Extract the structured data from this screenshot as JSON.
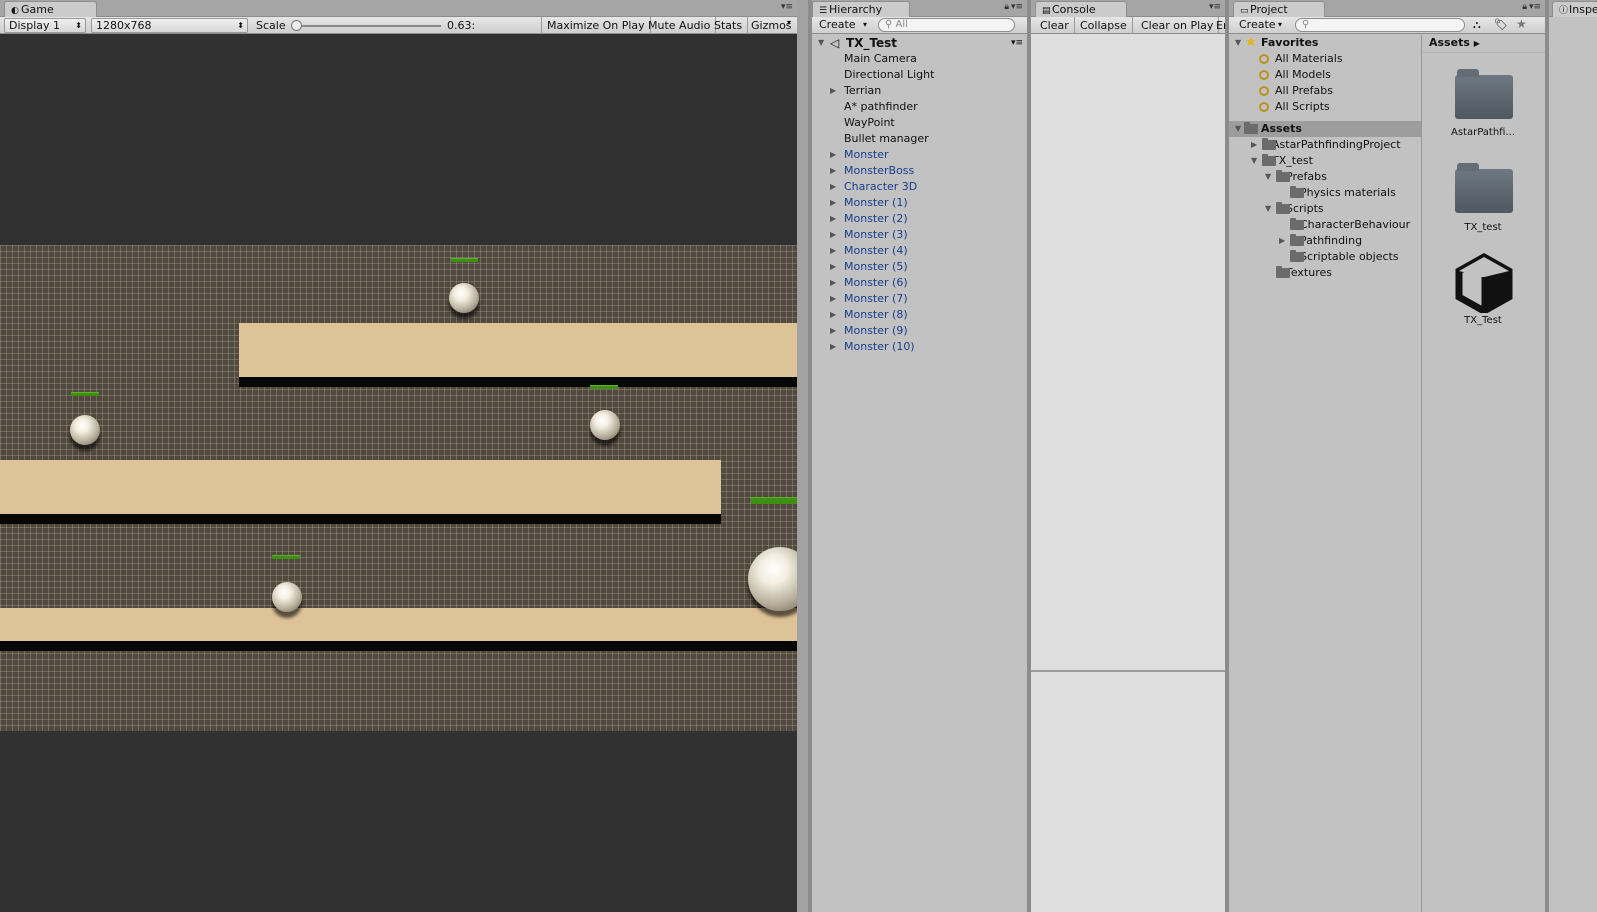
{
  "game": {
    "tab": "Game",
    "display": "Display 1",
    "resolution": "1280x768",
    "scale_label": "Scale",
    "scale_value": "0.63:",
    "buttons": [
      "Maximize On Play",
      "Mute Audio",
      "Stats",
      "Gizmos"
    ]
  },
  "hierarchy": {
    "tab": "Hierarchy",
    "create": "Create",
    "search_placeholder": "All",
    "scene": "TX_Test",
    "items": [
      {
        "label": "Main Camera",
        "blue": false,
        "fold": false
      },
      {
        "label": "Directional Light",
        "blue": false,
        "fold": false
      },
      {
        "label": "Terrian",
        "blue": false,
        "fold": true
      },
      {
        "label": "A* pathfinder",
        "blue": false,
        "fold": false
      },
      {
        "label": "WayPoint",
        "blue": false,
        "fold": false
      },
      {
        "label": "Bullet manager",
        "blue": false,
        "fold": false
      },
      {
        "label": "Monster",
        "blue": true,
        "fold": true
      },
      {
        "label": "MonsterBoss",
        "blue": true,
        "fold": true
      },
      {
        "label": "Character 3D",
        "blue": true,
        "fold": true
      },
      {
        "label": "Monster (1)",
        "blue": true,
        "fold": true
      },
      {
        "label": "Monster (2)",
        "blue": true,
        "fold": true
      },
      {
        "label": "Monster (3)",
        "blue": true,
        "fold": true
      },
      {
        "label": "Monster (4)",
        "blue": true,
        "fold": true
      },
      {
        "label": "Monster (5)",
        "blue": true,
        "fold": true
      },
      {
        "label": "Monster (6)",
        "blue": true,
        "fold": true
      },
      {
        "label": "Monster (7)",
        "blue": true,
        "fold": true
      },
      {
        "label": "Monster (8)",
        "blue": true,
        "fold": true
      },
      {
        "label": "Monster (9)",
        "blue": true,
        "fold": true
      },
      {
        "label": "Monster (10)",
        "blue": true,
        "fold": true
      }
    ]
  },
  "console": {
    "tab": "Console",
    "buttons": [
      "Clear",
      "Collapse",
      "Clear on Play",
      "Er"
    ]
  },
  "project": {
    "tab": "Project",
    "create": "Create",
    "favorites_label": "Favorites",
    "favorites": [
      "All Materials",
      "All Models",
      "All Prefabs",
      "All Scripts"
    ],
    "assets_label": "Assets",
    "tree": [
      {
        "label": "AstarPathfindingProject",
        "depth": 1,
        "fold": "closed"
      },
      {
        "label": "TX_test",
        "depth": 1,
        "fold": "open"
      },
      {
        "label": "Prefabs",
        "depth": 2,
        "fold": "open"
      },
      {
        "label": "Physics materials",
        "depth": 3,
        "fold": "none"
      },
      {
        "label": "Scripts",
        "depth": 2,
        "fold": "open"
      },
      {
        "label": "CharacterBehaviour",
        "depth": 3,
        "fold": "none"
      },
      {
        "label": "Pathfinding",
        "depth": 3,
        "fold": "closed"
      },
      {
        "label": "Scriptable objects",
        "depth": 3,
        "fold": "none"
      },
      {
        "label": "Textures",
        "depth": 2,
        "fold": "none"
      }
    ],
    "breadcrumb": "Assets",
    "grid": [
      "AstarPathfi...",
      "TX_test",
      "TX_Test"
    ]
  },
  "inspector": {
    "tab": "Inspe"
  },
  "colors": {
    "prefab_text": "#1a3c8c",
    "platform": "#dfc398",
    "health_bar": "#3f8f12",
    "game_bg": "#313131"
  }
}
